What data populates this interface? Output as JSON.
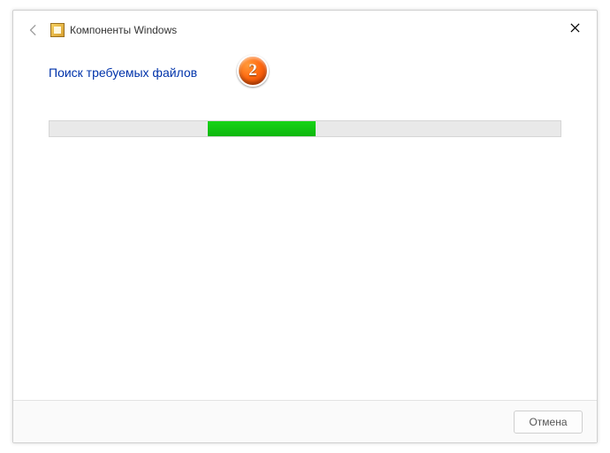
{
  "window": {
    "title": "Компоненты Windows"
  },
  "content": {
    "heading": "Поиск требуемых файлов",
    "badge_number": "2",
    "progress": {
      "left_percent": 31,
      "width_percent": 21
    }
  },
  "footer": {
    "cancel_label": "Отмена"
  }
}
